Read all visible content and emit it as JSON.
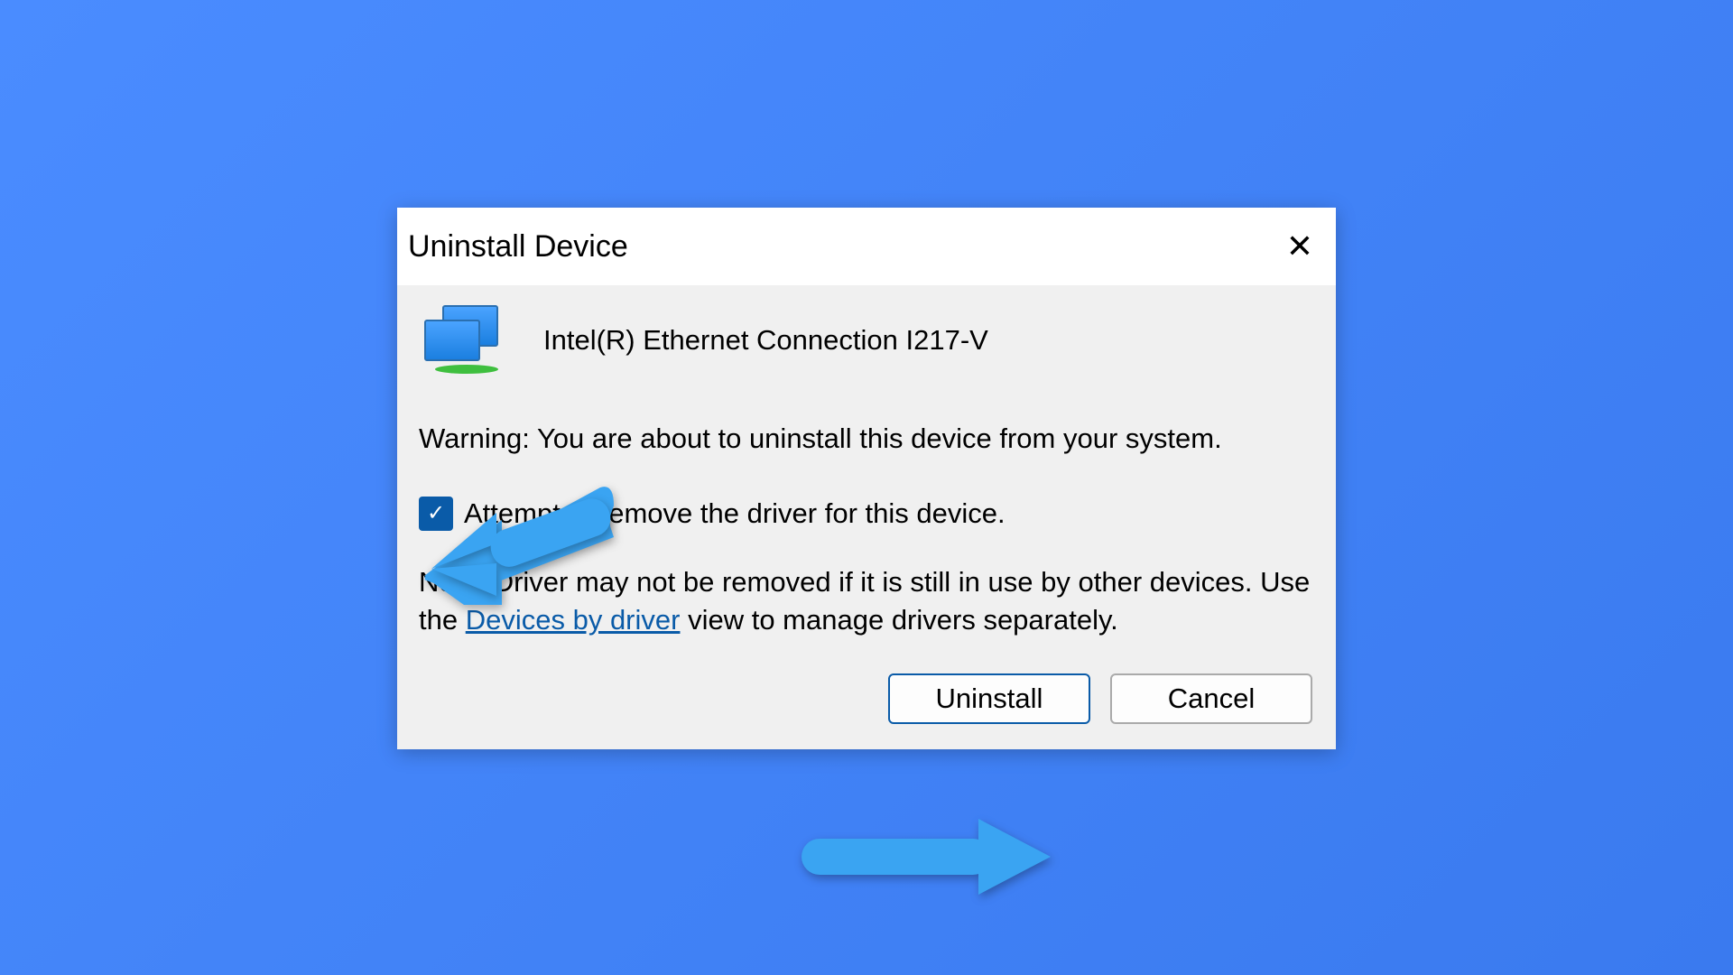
{
  "dialog": {
    "title": "Uninstall Device",
    "device_name": "Intel(R) Ethernet Connection I217-V",
    "warning": "Warning: You are about to uninstall this device from your system.",
    "checkbox_label": "Attempt to remove the driver for this device.",
    "note_prefix": "Note: Driver may not be removed if it is still in use by other devices. Use the ",
    "note_link": "Devices by driver",
    "note_suffix": " view to manage drivers separately.",
    "uninstall_label": "Uninstall",
    "cancel_label": "Cancel"
  }
}
